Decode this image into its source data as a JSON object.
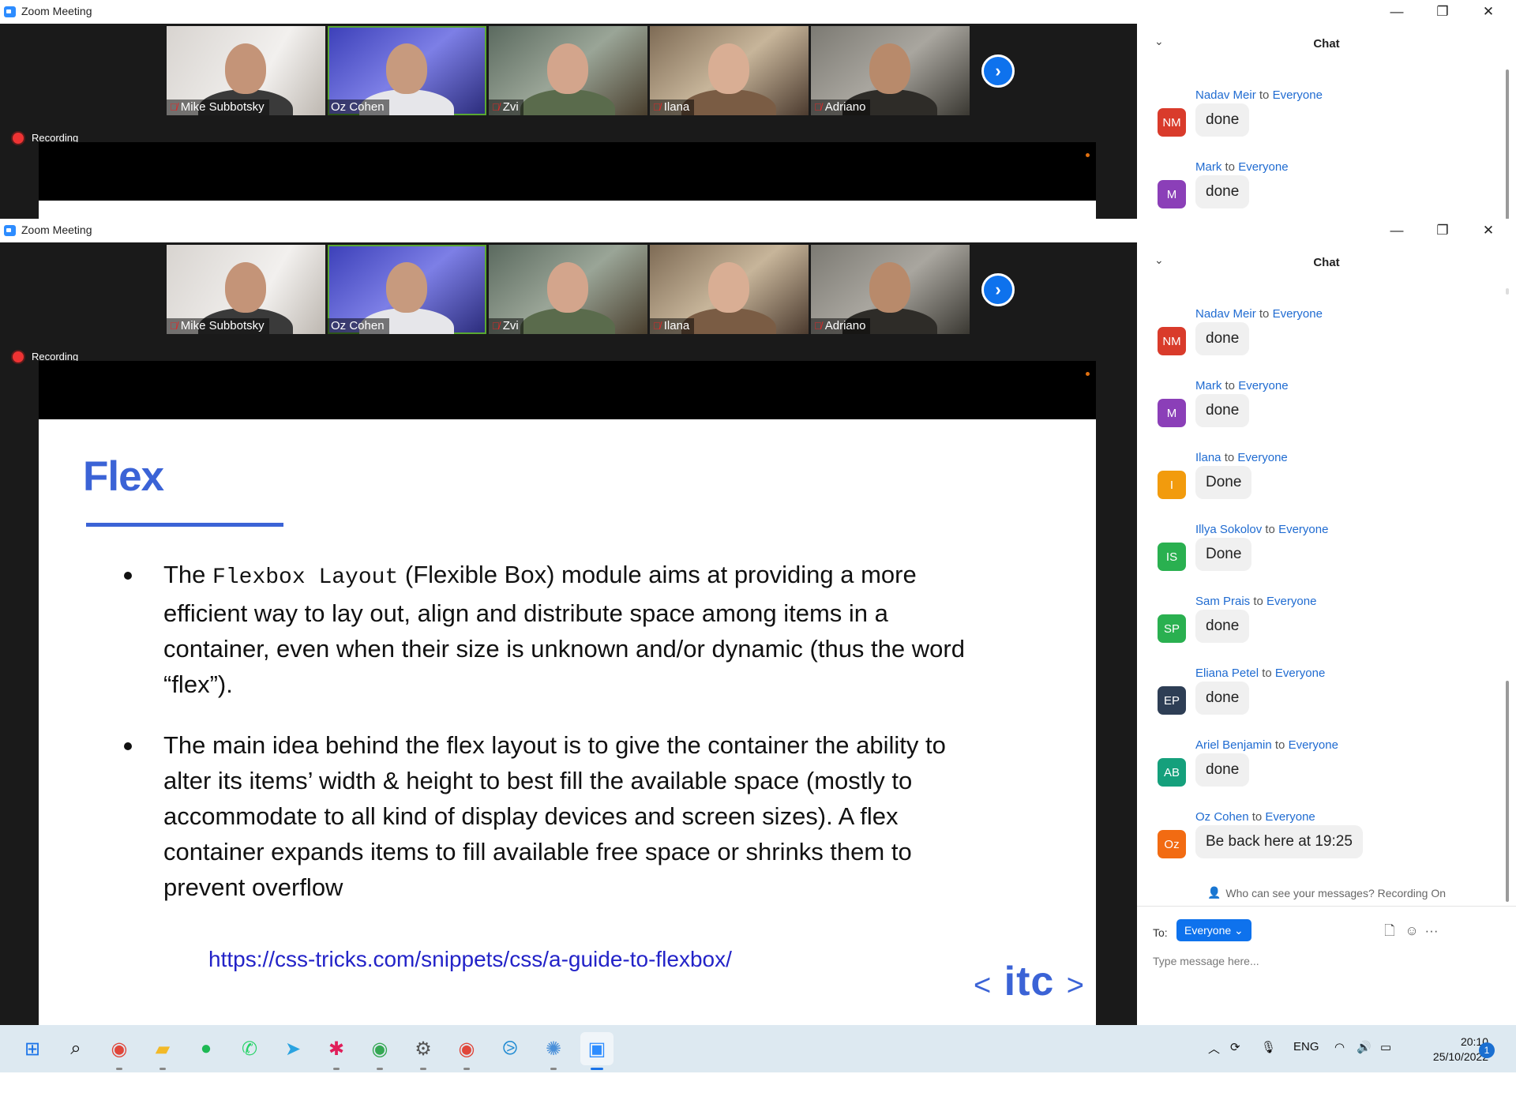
{
  "window": {
    "title": "Zoom Meeting",
    "minimize": "—",
    "maximize": "❐",
    "close": "✕"
  },
  "recording_label": "Recording",
  "participants_top": [
    {
      "name": "Mike Subbotsky",
      "muted": true
    },
    {
      "name": "Oz Cohen",
      "muted": false
    },
    {
      "name": "Zvi",
      "muted": true
    },
    {
      "name": "Ilana",
      "muted": true
    },
    {
      "name": "Adriano",
      "muted": true
    }
  ],
  "participants_bottom": [
    {
      "name": "Mike Subbotsky",
      "muted": true
    },
    {
      "name": "Oz Cohen",
      "muted": false
    },
    {
      "name": "Zvi",
      "muted": true
    },
    {
      "name": "Ilana",
      "muted": true
    },
    {
      "name": "Adriano",
      "muted": true
    }
  ],
  "next_page_icon": "chevron-right-icon",
  "slide": {
    "title": "Flex",
    "bullet1": {
      "pre": "The ",
      "code": "Flexbox Layout",
      "post": " (Flexible Box) module aims at providing a more efficient way to lay out, align and distribute space among items in a container, even when their size is unknown and/or dynamic (thus the word “flex”)."
    },
    "bullet2": "The main idea behind the flex layout is to give the container the ability to alter its items’ width & height to best fill the available space (mostly to accommodate to all kind of display devices and screen sizes). A flex container expands items to fill available free space or shrinks them to prevent overflow",
    "link": "https://css-tricks.com/snippets/css/a-guide-to-flexbox/",
    "logo": {
      "left": "<",
      "text": "itc",
      "right": ">"
    }
  },
  "chat": {
    "title": "Chat",
    "collapse_icon": "chevron-down-icon",
    "to_word": "to",
    "recipient": "Everyone",
    "messages_top": [
      {
        "sender": "Nadav Meir",
        "initials": "NM",
        "color": "#d93b2b",
        "text": "done"
      },
      {
        "sender": "Mark",
        "initials": "M",
        "color": "#8b3fb8",
        "text": "done"
      }
    ],
    "messages": [
      {
        "sender": "Nadav Meir",
        "initials": "NM",
        "color": "#d93b2b",
        "text": "done"
      },
      {
        "sender": "Mark",
        "initials": "M",
        "color": "#8b3fb8",
        "text": "done"
      },
      {
        "sender": "Ilana",
        "initials": "I",
        "color": "#f29b0d",
        "text": "Done"
      },
      {
        "sender": "Illya Sokolov",
        "initials": "IS",
        "color": "#2ab050",
        "text": "Done"
      },
      {
        "sender": "Sam Prais",
        "initials": "SP",
        "color": "#2ab050",
        "text": "done"
      },
      {
        "sender": "Eliana Petel",
        "initials": "EP",
        "color": "#2e3e55",
        "text": "done"
      },
      {
        "sender": "Ariel Benjamin",
        "initials": "AB",
        "color": "#15a07c",
        "text": "done"
      },
      {
        "sender": "Oz Cohen",
        "initials": "Oz",
        "color": "#f26b12",
        "text": "Be back here at 19:25"
      }
    ],
    "hint": "Who can see your messages? Recording On",
    "to_label": "To:",
    "to_value": "Everyone",
    "input_placeholder": "Type message here...",
    "tools": [
      "file-icon",
      "emoji-icon",
      "more-icon"
    ]
  },
  "taskbar": {
    "apps": [
      "windows-start-icon",
      "search-icon",
      "chrome-icon",
      "file-explorer-icon",
      "spotify-icon",
      "whatsapp-icon",
      "telegram-icon",
      "slack-icon",
      "chrome-profile-icon",
      "settings-icon",
      "chrome-icon",
      "vscode-icon",
      "network-tool-icon",
      "zoom-icon"
    ],
    "tray_lang": "ENG",
    "time": "20:10",
    "date": "25/10/2022",
    "notifications": "1"
  }
}
